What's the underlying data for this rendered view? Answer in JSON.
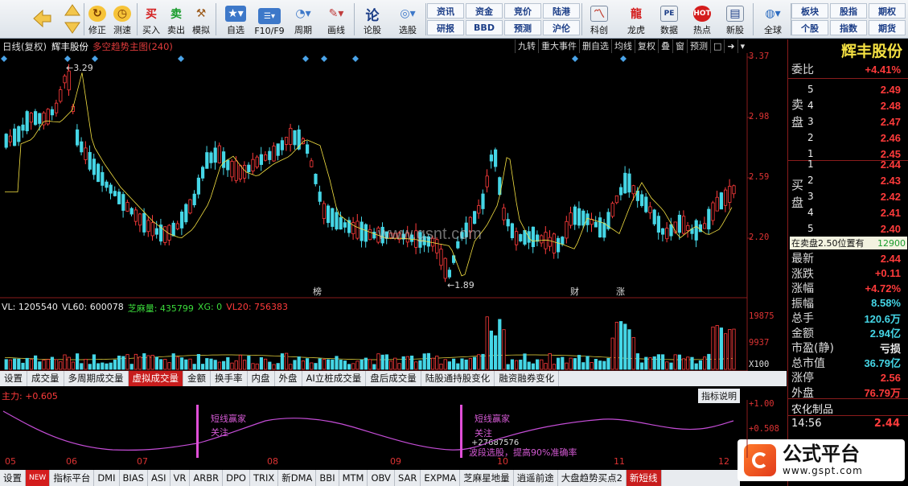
{
  "toolbar": {
    "buttons": [
      {
        "label": "修正",
        "icon": "repair-icon"
      },
      {
        "label": "测速",
        "icon": "clock-icon"
      },
      {
        "label": "买入",
        "icon": "buy-icon"
      },
      {
        "label": "卖出",
        "icon": "sell-icon"
      },
      {
        "label": "模拟",
        "icon": "hammer-icon"
      },
      {
        "label": "自选",
        "icon": "star-icon"
      },
      {
        "label": "F10/F9",
        "icon": "f10-icon"
      },
      {
        "label": "周期",
        "icon": "period-icon"
      },
      {
        "label": "画线",
        "icon": "pen-icon"
      },
      {
        "label": "论股",
        "icon": "discuss-icon"
      },
      {
        "label": "选股",
        "icon": "select-stock-icon"
      },
      {
        "label": "科创",
        "icon": "kechuang-icon"
      },
      {
        "label": "龙虎",
        "icon": "dragon-tiger-icon"
      },
      {
        "label": "数据",
        "icon": "data-icon"
      },
      {
        "label": "热点",
        "icon": "hot-icon"
      },
      {
        "label": "新股",
        "icon": "new-stock-icon"
      },
      {
        "label": "全球",
        "icon": "globe-icon"
      }
    ],
    "small_buttons": [
      "资讯",
      "资金",
      "竞价",
      "陆港",
      "研报",
      "BBD",
      "预测",
      "沪伦",
      "板块",
      "股指",
      "期权",
      "个股",
      "指数",
      "期货"
    ]
  },
  "chart": {
    "period_label": "日线(复权)",
    "stock_name": "辉丰股份",
    "indicator_name": "多空趋势主图(240)",
    "buttons": [
      "九转",
      "重大事件",
      "删自选",
      "均线",
      "复权",
      "叠",
      "窗",
      "预测"
    ],
    "y_labels": [
      "3.37",
      "2.98",
      "2.59",
      "2.20"
    ],
    "high_marker": "3.29",
    "low_marker": "1.89",
    "event_marks": [
      "榜",
      "财",
      "涨"
    ],
    "watermark": "www.gsnt.com",
    "volume_line": [
      "VL: 1205540",
      "VL60: 600078",
      "芝麻量: 435799",
      "XG: 0",
      "VL20: 756383"
    ],
    "volume_y_labels": [
      "19875",
      "9937",
      "X100"
    ],
    "main_force": "主力: +0.605",
    "main_force_y_labels": [
      "+1.00",
      "+0.508"
    ],
    "indicator_desc_button": "指标说明",
    "annotations": [
      "短线赢家",
      "关注",
      "短线赢家",
      "关注",
      "波段选股，提高90%准确率",
      "+27687576"
    ],
    "dates": [
      "05",
      "06",
      "07",
      "08",
      "09",
      "10",
      "11",
      "12"
    ]
  },
  "indicator_tabs": [
    "设置",
    "成交量",
    "多周期成交量",
    "虚拟成交量",
    "金额",
    "换手率",
    "内盘",
    "外盘",
    "AI立桩成交量",
    "盘后成交量",
    "陆股通持股变化",
    "融资融券变化"
  ],
  "active_indicator_tab": "虚拟成交量",
  "bottom_tabs": [
    "设置",
    "NEW",
    "指标平台",
    "DMI",
    "BIAS",
    "ASI",
    "VR",
    "ARBR",
    "DPO",
    "TRIX",
    "新DMA",
    "BBI",
    "MTM",
    "OBV",
    "SAR",
    "EXPMA",
    "芝麻星地量",
    "逍遥前途",
    "大盘趋势买点2",
    "新短线"
  ],
  "active_bottom_tab": "新短线",
  "right_panel": {
    "title": "辉丰股份",
    "webi_label": "委比",
    "webi_value": "+4.41%",
    "sell_label": "卖盘",
    "buy_label": "买盘",
    "sell": [
      {
        "level": "5",
        "price": "2.49"
      },
      {
        "level": "4",
        "price": "2.48"
      },
      {
        "level": "3",
        "price": "2.47"
      },
      {
        "level": "2",
        "price": "2.46"
      },
      {
        "level": "1",
        "price": "2.45"
      }
    ],
    "buy": [
      {
        "level": "1",
        "price": "2.44"
      },
      {
        "level": "2",
        "price": "2.43"
      },
      {
        "level": "3",
        "price": "2.42"
      },
      {
        "level": "4",
        "price": "2.41"
      },
      {
        "level": "5",
        "price": "2.40"
      }
    ],
    "tooltip": "在卖盘2.50位置有",
    "tooltip_value": "12900",
    "stats": [
      {
        "label": "最新",
        "value": "2.44",
        "color": "red"
      },
      {
        "label": "涨跌",
        "value": "+0.11",
        "color": "red"
      },
      {
        "label": "涨幅",
        "value": "+4.72%",
        "color": "red"
      },
      {
        "label": "振幅",
        "value": "8.58%",
        "color": "cyan"
      },
      {
        "label": "总手",
        "value": "120.6万",
        "color": "cyan"
      },
      {
        "label": "金额",
        "value": "2.94亿",
        "color": "cyan"
      },
      {
        "label": "市盈(静)",
        "value": "亏损",
        "color": "white"
      },
      {
        "label": "总市值",
        "value": "36.79亿",
        "color": "cyan"
      },
      {
        "label": "涨停",
        "value": "2.56",
        "color": "red"
      },
      {
        "label": "外盘",
        "value": "76.79万",
        "color": "red"
      }
    ],
    "sector": "农化制品",
    "time": "14:56",
    "last_price": "2.44"
  },
  "badge": {
    "text": "公式平台",
    "url": "www.gspt.com"
  },
  "colors": {
    "up": "#ff3b3b",
    "down": "#45d6e6",
    "ma": "#f5e142"
  }
}
